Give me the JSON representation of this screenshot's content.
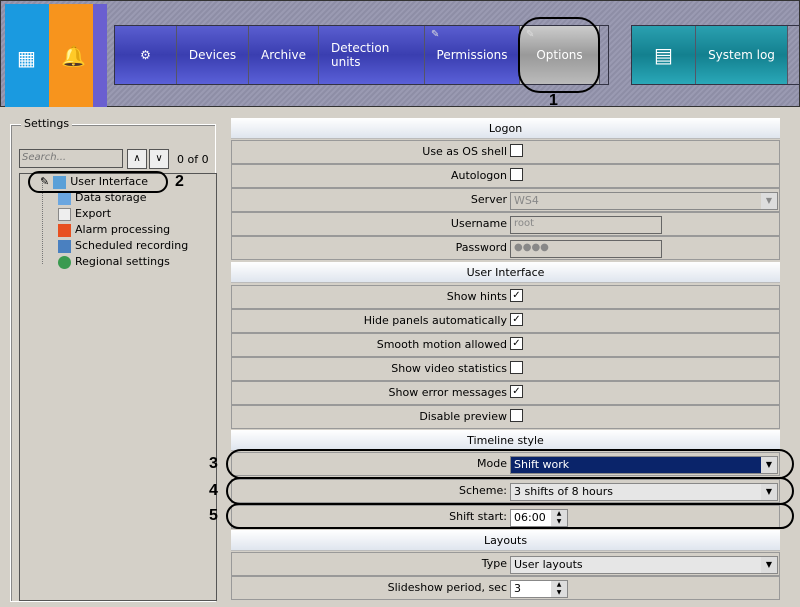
{
  "topbar": {
    "nav": [
      "Devices",
      "Archive",
      "Detection units",
      "Permissions",
      "Options"
    ],
    "system_log": "System log"
  },
  "annotations": [
    "1",
    "2",
    "3",
    "4",
    "5"
  ],
  "settings": {
    "title": "Settings",
    "search_placeholder": "Search...",
    "count": "0 of 0",
    "tree": [
      "User Interface",
      "Data storage",
      "Export",
      "Alarm processing",
      "Scheduled recording",
      "Regional settings"
    ]
  },
  "sections": {
    "logon": "Logon",
    "ui": "User Interface",
    "timeline": "Timeline style",
    "layouts": "Layouts"
  },
  "logon": {
    "os_shell": "Use as OS shell",
    "autologon": "Autologon",
    "server": "Server",
    "server_val": "WS4",
    "username": "Username",
    "username_val": "root",
    "password": "Password",
    "password_val": "●●●●"
  },
  "ui": {
    "rows": [
      {
        "label": "Show hints",
        "checked": "✓"
      },
      {
        "label": "Hide panels automatically",
        "checked": "✓"
      },
      {
        "label": "Smooth motion allowed",
        "checked": "✓"
      },
      {
        "label": "Show video statistics",
        "checked": ""
      },
      {
        "label": "Show error messages",
        "checked": "✓"
      },
      {
        "label": "Disable preview",
        "checked": ""
      }
    ]
  },
  "timeline": {
    "mode": "Mode",
    "mode_val": "Shift work",
    "scheme": "Scheme:",
    "scheme_val": "3 shifts of 8 hours",
    "shift": "Shift start:",
    "shift_val": "06:00"
  },
  "layouts": {
    "type": "Type",
    "type_val": "User layouts",
    "slide": "Slideshow period, sec",
    "slide_val": "3"
  },
  "colors": {
    "selected": "#0a246a"
  }
}
